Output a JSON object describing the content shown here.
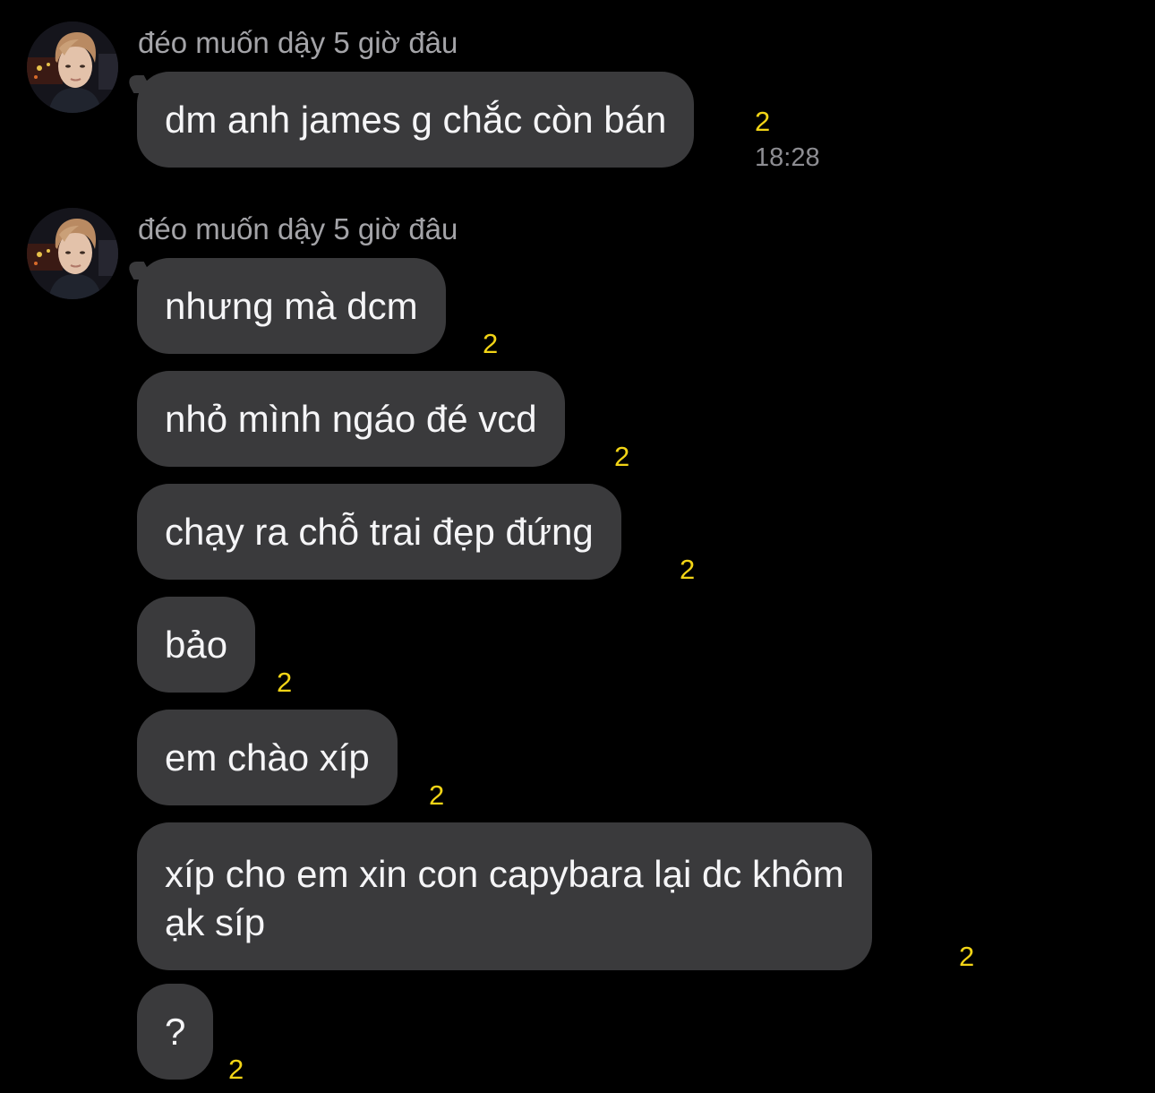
{
  "groups": [
    {
      "sender": "đéo muốn dậy 5 giờ đâu",
      "messages": [
        {
          "text": "dm anh james g chắc còn bán",
          "count": "2",
          "time": "18:28"
        }
      ]
    },
    {
      "sender": "đéo muốn dậy 5 giờ đâu",
      "messages": [
        {
          "text": "nhưng mà dcm",
          "count": "2"
        },
        {
          "text": "nhỏ mình ngáo đé vcd",
          "count": "2"
        },
        {
          "text": "chạy ra chỗ trai đẹp đứng",
          "count": "2"
        },
        {
          "text": "bảo",
          "count": "2"
        },
        {
          "text": "em chào xíp",
          "count": "2"
        },
        {
          "text_line1": "xíp cho em xin con capybara lại dc khôm",
          "text_line2": "ạk síp",
          "count": "2"
        },
        {
          "text": "?",
          "count": "2"
        }
      ]
    }
  ],
  "colors": {
    "background": "#000000",
    "bubble": "#3a3a3c",
    "sender_name": "#a4a4a8",
    "count_badge": "#f2d416",
    "timestamp": "#8d8d92"
  },
  "icons": {
    "avatar": "user-avatar-photo"
  }
}
